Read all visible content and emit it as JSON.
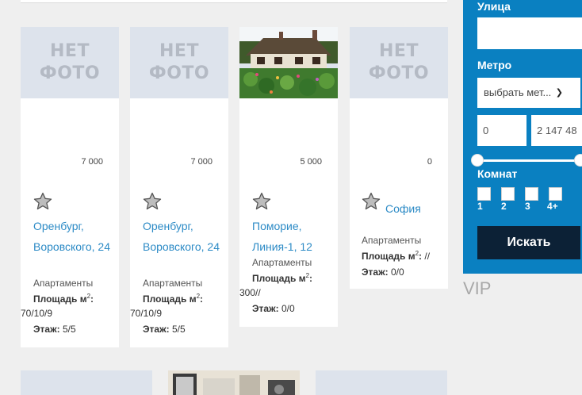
{
  "listings": [
    {
      "photo": "none",
      "no_photo_line1": "НЕТ",
      "no_photo_line2": "ФОТО",
      "price": "7 000",
      "title": "Оренбург, Воровского, 24",
      "type": "Апартаменты",
      "area_label": "Площадь м",
      "area_sup": "2",
      "area_suffix": ":",
      "area_value": "70/10/9",
      "floor_label": "Этаж:",
      "floor_value": "5/5"
    },
    {
      "photo": "none",
      "no_photo_line1": "НЕТ",
      "no_photo_line2": "ФОТО",
      "price": "7 000",
      "title": "Оренбург, Воровского, 24",
      "type": "Апартаменты",
      "area_label": "Площадь м",
      "area_sup": "2",
      "area_suffix": ":",
      "area_value": "70/10/9",
      "floor_label": "Этаж:",
      "floor_value": "5/5"
    },
    {
      "photo": "cottage-image",
      "price": "5 000",
      "title": "Поморие, Линия-1, 12",
      "type": "Апартаменты",
      "area_label": "Площадь м",
      "area_sup": "2",
      "area_suffix": ":",
      "area_value": "300//",
      "floor_label": "Этаж:",
      "floor_value": "0/0"
    },
    {
      "photo": "none",
      "no_photo_line1": "НЕТ",
      "no_photo_line2": "ФОТО",
      "price": "0",
      "title": "София",
      "type": "Апартаменты",
      "area_label": "Площадь м",
      "area_sup": "2",
      "area_suffix": ":",
      "area_value": "//",
      "floor_label": "Этаж:",
      "floor_value": "0/0"
    }
  ],
  "sidebar": {
    "street_label": "Улица",
    "street_value": "",
    "metro_label": "Метро",
    "metro_selected": "выбрать мет...",
    "price_min": "0",
    "price_max": "2 147 48",
    "rooms_label": "Комнат",
    "rooms": [
      "1",
      "2",
      "3",
      "4+"
    ],
    "search_button": "Искать",
    "chevron_icon": "chevron-down-icon"
  },
  "vip_label": "VIP",
  "colors": {
    "accent": "#0a80c1",
    "link": "#2d8bc6",
    "button_dark": "#0c2136",
    "no_photo_bg": "#dde3ec",
    "page_bg": "#efefef"
  }
}
